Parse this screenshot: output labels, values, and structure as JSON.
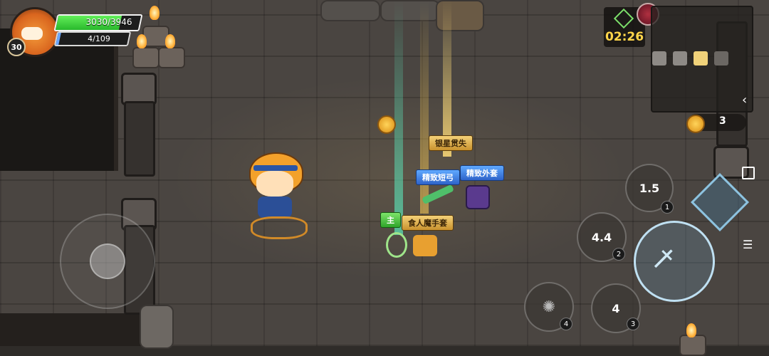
{
  "player": {
    "level": "30",
    "hp_text": "3030/3946",
    "hp_fraction": 0.768,
    "mp_text": "4/109",
    "mp_fraction": 0.037,
    "avatar_icon": "orange-mushroom-avatar-icon"
  },
  "hud": {
    "timer": "02:26",
    "timer_icon": "stopwatch-icon",
    "boss_icon": "boss-skull-icon",
    "coin_count": "3",
    "collapse_icon": "chevron-left-icon"
  },
  "minimap": {
    "rooms": [
      {
        "state": "explored",
        "color": "#8e8a86"
      },
      {
        "state": "explored",
        "color": "#8e8a86"
      },
      {
        "state": "current",
        "color": "#f1d27a"
      },
      {
        "state": "unexplored",
        "color": "#6b6763"
      }
    ]
  },
  "items": {
    "silver_star": "银星贯失",
    "fine_bow": "精致短弓",
    "fine_coat": "精致外套",
    "main_weapon_tag": "主",
    "gloves": "食人魔手套"
  },
  "skills": {
    "skill1": {
      "cooldown": "1.5",
      "slot": "1",
      "icon": "crossed-axes-icon"
    },
    "skill2": {
      "cooldown": "4.4",
      "slot": "2",
      "icon": "fist-icon"
    },
    "skill3": {
      "cooldown": "4",
      "slot": "3",
      "icon": "spiral-icon"
    },
    "skill4": {
      "slot": "4",
      "icon": "octopus-icon"
    },
    "attack_icon": "sword-icon",
    "switch_icon": "wolf-diamond-icon"
  },
  "system": {
    "square_icon": "square-icon",
    "menu_icon": "menu-icon"
  },
  "colors": {
    "hp": "#3fd43a",
    "timer": "#ffd54a",
    "beam_green": "#5be0b5",
    "beam_gold": "#ffcf55"
  }
}
